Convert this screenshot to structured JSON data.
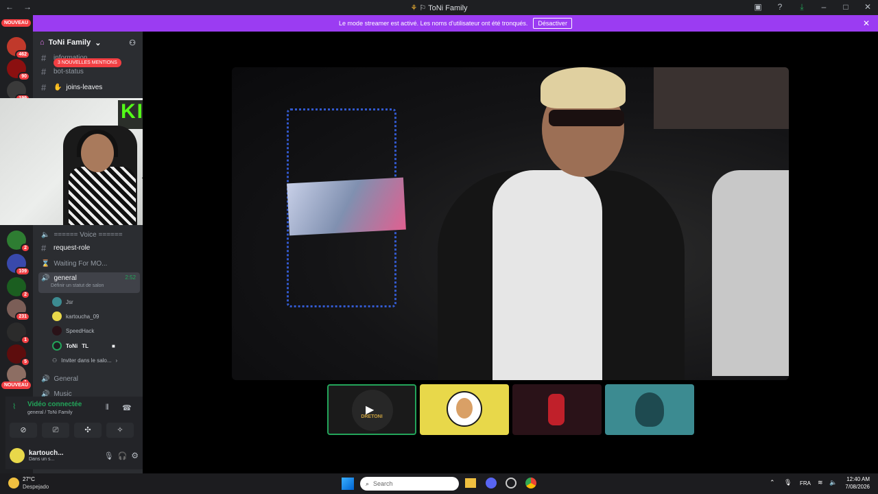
{
  "window": {
    "title": "ToNi Family",
    "back": "←",
    "forward": "→",
    "controls": [
      "▣",
      "?",
      "⤓",
      "–",
      "□",
      "✕"
    ]
  },
  "banner": {
    "text": "Le mode streamer est activé. Les noms d'utilisateur ont été tronqués.",
    "button": "Désactiver",
    "close": "✕"
  },
  "servers": {
    "badges": [
      "462",
      "90",
      "199",
      "3",
      "2",
      "109",
      "2",
      "231",
      "1",
      "5",
      "1"
    ],
    "nouveau": "NOUVEAU"
  },
  "sidebar": {
    "server_name": "ToNi Family",
    "mention_pill": "3 NOUVELLES MENTIONS",
    "channels_top": [
      {
        "icon": "#",
        "name": "information"
      },
      {
        "icon": "#",
        "name": "bot-status"
      },
      {
        "icon": "#",
        "name": "joins-leaves"
      }
    ],
    "voice_header": "====== Voice ======",
    "channels_mid": [
      {
        "icon": "#",
        "name": "request-role"
      },
      {
        "icon": "🔊",
        "name": "Waiting For MO..."
      }
    ],
    "active_channel": {
      "name": "general",
      "timer": "2:52",
      "status": "Définir un statut de salon"
    },
    "voice_users": [
      "Jsr",
      "kartoucha_09",
      "SpeedHack",
      "ToNi",
      "TL"
    ],
    "invite": "Inviter dans le salo...",
    "channels_bottom": [
      {
        "icon": "🔊",
        "name": "General"
      },
      {
        "icon": "🔊",
        "name": "Music"
      }
    ]
  },
  "voice_panel": {
    "status": "Vidéo connectée",
    "location": "general / ToNi Family"
  },
  "user_panel": {
    "name": "kartouch...",
    "status": "Dans un s..."
  },
  "pip": {
    "sign": "KICK"
  },
  "tiles": {
    "tile1_label": "DRETONI"
  },
  "taskbar": {
    "weather_temp": "27°C",
    "weather_desc": "Despejado",
    "search_placeholder": "Search",
    "lang": "FRA",
    "time": "12:40 AM",
    "date": "7/08/2026"
  },
  "colors": {
    "accent": "#9b3cf2",
    "active_green": "#23a55a",
    "tile_yellow": "#e8d84a",
    "tile_teal": "#3c8b91",
    "tile_dark": "#2a1218"
  }
}
